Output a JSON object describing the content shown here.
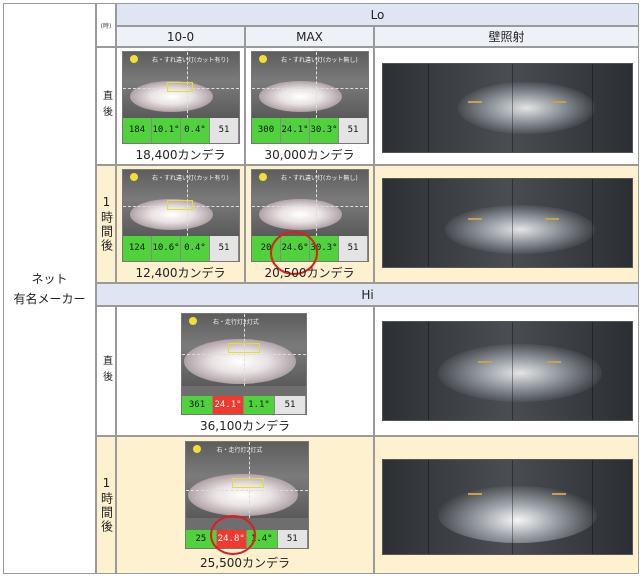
{
  "header": {
    "time_unit": "(時)",
    "lo": "Lo",
    "hi": "Hi",
    "col_100": "10-0",
    "col_max": "MAX",
    "col_wall": "壁照射"
  },
  "product": "ネット\n有名メーカー",
  "rows": {
    "immediate": "直後",
    "one_hour": "1時間後"
  },
  "lo_immediate": {
    "meter_100": {
      "title": "右・すれ違い灯(カット有り)",
      "readings": [
        "184",
        "10.1°",
        "0.4°",
        "51"
      ]
    },
    "meter_max": {
      "title": "右・すれ違い灯(カット無し)",
      "readings": [
        "300",
        "24.1°",
        "30.3°",
        "51"
      ]
    },
    "value_100": "18,400カンデラ",
    "value_max": "30,000カンデラ"
  },
  "lo_1h": {
    "meter_100": {
      "title": "右・すれ違い灯(カット有り)",
      "readings": [
        "124",
        "10.6°",
        "0.4°",
        "51"
      ]
    },
    "meter_max": {
      "title": "右・すれ違い灯(カット無し)",
      "readings": [
        "20",
        "24.6°",
        "30.3°",
        "51"
      ]
    },
    "value_100": "12,400カンデラ",
    "value_max": "20,500カンデラ"
  },
  "hi_immediate": {
    "meter": {
      "title": "右・走行灯2灯式",
      "readings": [
        "361",
        "24.1°",
        "1.1°",
        "51"
      ]
    },
    "value": "36,100カンデラ"
  },
  "hi_1h": {
    "meter": {
      "title": "右・走行灯2灯式",
      "readings": [
        "25",
        "24.8°",
        "1.4°",
        "51"
      ]
    },
    "value": "25,500カンデラ"
  },
  "colors": {
    "header_blue": "#dfe5f2",
    "cream": "#fdf1cf",
    "meter_green": "#4fd23b",
    "meter_red": "#f13a2d",
    "ring_red": "#e31b1b"
  }
}
